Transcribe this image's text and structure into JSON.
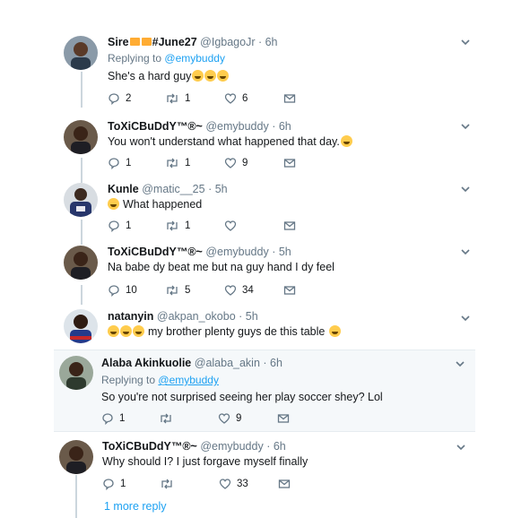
{
  "tweets": [
    {
      "name": "Sire",
      "name_suffix": "#June27",
      "handle": "@IgbagoJr",
      "time": "6h",
      "replying_prefix": "Replying to",
      "replying_to": "@emybuddy",
      "text": "She's a hard guy",
      "text_emojis": [
        "face-with-tears-of-joy",
        "face-with-tears-of-joy",
        "face-with-tears-of-joy"
      ],
      "counts": {
        "reply": "2",
        "retweet": "1",
        "like": "6"
      }
    },
    {
      "name": "ToXiCBuDdY™®~",
      "handle": "@emybuddy",
      "time": "6h",
      "text": "You won't understand what happened that day.",
      "text_emojis": [
        "rolling-on-floor-laughing"
      ],
      "counts": {
        "reply": "1",
        "retweet": "1",
        "like": "9"
      }
    },
    {
      "name": "Kunle",
      "handle": "@matic__25",
      "time": "5h",
      "text": "What happened",
      "leading_emojis": [
        "face-with-tears-of-joy"
      ],
      "counts": {
        "reply": "1",
        "retweet": "1",
        "like": ""
      }
    },
    {
      "name": "ToXiCBuDdY™®~",
      "handle": "@emybuddy",
      "time": "5h",
      "text": "Na babe dy beat me but na guy hand I dy feel",
      "counts": {
        "reply": "10",
        "retweet": "5",
        "like": "34"
      }
    },
    {
      "name": "natanyin",
      "handle": "@akpan_okobo",
      "time": "5h",
      "text": "my brother plenty guys de this table",
      "leading_emojis": [
        "rolling-on-floor-laughing",
        "face-with-tears-of-joy",
        "grinning-face-with-sweat"
      ],
      "text_emojis": [
        "face-with-tears-of-joy"
      ],
      "counts": {}
    },
    {
      "name": "Alaba Akinkuolie",
      "handle": "@alaba_akin",
      "time": "6h",
      "replying_prefix": "Replying to",
      "replying_to": "@emybuddy",
      "text": "So you're not surprised seeing her play soccer shey? Lol",
      "counts": {
        "reply": "1",
        "retweet": "",
        "like": "9"
      }
    },
    {
      "name": "ToXiCBuDdY™®~",
      "handle": "@emybuddy",
      "time": "6h",
      "text": "Why should I? I just forgave myself finally",
      "counts": {
        "reply": "1",
        "retweet": "",
        "like": "33"
      }
    }
  ],
  "more_replies": "1 more reply",
  "colors": {
    "accent": "#1da1f2",
    "muted": "#657786",
    "line": "#ccd6dd",
    "highlight_bg": "#f5f8fa"
  }
}
